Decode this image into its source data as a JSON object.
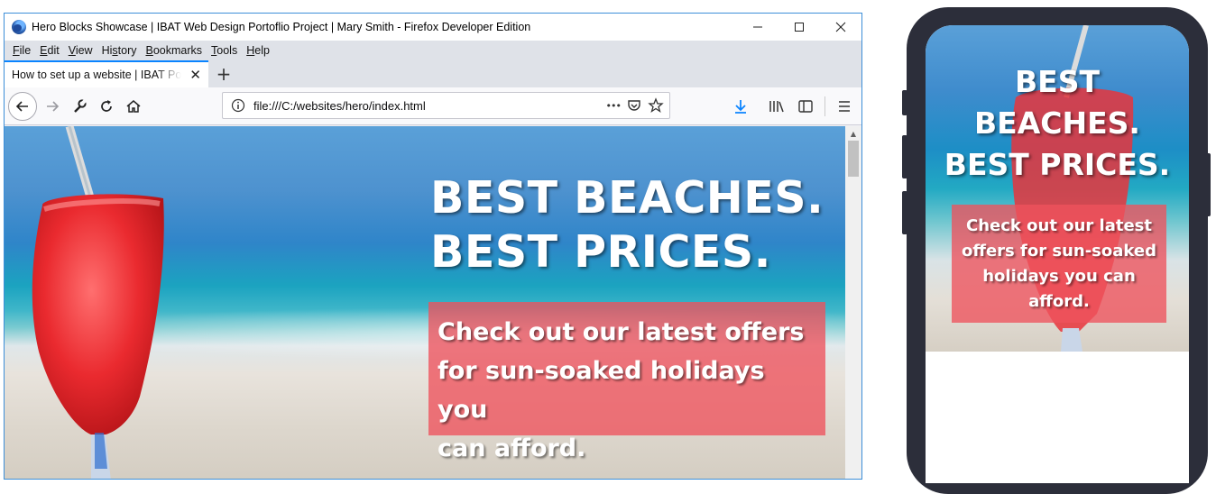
{
  "browser": {
    "title": "Hero Blocks Showcase | IBAT Web Design Portoflio Project | Mary Smith - Firefox Developer Edition",
    "window_controls": {
      "minimize": "—",
      "maximize": "☐",
      "close": "✕"
    },
    "menu": [
      {
        "accel": "F",
        "rest": "ile"
      },
      {
        "accel": "E",
        "rest": "dit"
      },
      {
        "accel": "V",
        "rest": "iew"
      },
      {
        "accel": "",
        "pre": "Hi",
        "accel2": "s",
        "rest": "tory"
      },
      {
        "accel": "B",
        "rest": "ookmarks"
      },
      {
        "accel": "T",
        "rest": "ools"
      },
      {
        "accel": "H",
        "rest": "elp"
      }
    ],
    "menu_labels": [
      "File",
      "Edit",
      "View",
      "History",
      "Bookmarks",
      "Tools",
      "Help"
    ],
    "tab": {
      "title": "How to set up a website | IBAT Portfolio",
      "close": "✕"
    },
    "new_tab": "+",
    "url": "file:///C:/websites/hero/index.html",
    "url_more": "•••",
    "icons": [
      "back-icon",
      "forward-icon",
      "wrench-icon",
      "reload-icon",
      "home-icon",
      "info-icon",
      "pocket-icon",
      "star-icon",
      "download-icon",
      "library-icon",
      "sidebar-icon",
      "hamburger-menu-icon"
    ],
    "colors": {
      "accent": "#0a84ff",
      "window_border": "#3c8ed8",
      "hero_box": "#ee525c"
    }
  },
  "hero": {
    "headline_line1": "BEST BEACHES.",
    "headline_line2": "BEST PRICES.",
    "subtext_line1": "Check out our latest offers",
    "subtext_line2": "for sun-soaked holidays you",
    "subtext_line3": "can afford."
  },
  "mobile_hero": {
    "headline_line1": "BEST",
    "headline_line2": "BEACHES.",
    "headline_line3": "BEST PRICES.",
    "subtext_line1": "Check out our latest",
    "subtext_line2": "offers for sun-soaked",
    "subtext_line3": "holidays you can",
    "subtext_line4": "afford."
  }
}
